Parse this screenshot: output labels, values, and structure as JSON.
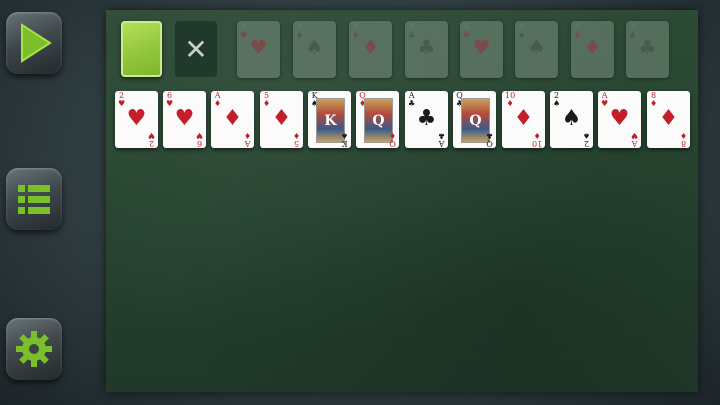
{
  "controls": {
    "play_icon": "play-icon",
    "menu_icon": "menu-list-icon",
    "settings_icon": "gear-icon",
    "accent": "#7bbf2a"
  },
  "stock": {
    "back_color": "#a6d448"
  },
  "waste": {
    "icon": "x-icon",
    "label": "✕"
  },
  "foundations": [
    {
      "rank": "A",
      "suit": "♥",
      "color": "red"
    },
    {
      "rank": "A",
      "suit": "♠",
      "color": "black"
    },
    {
      "rank": "A",
      "suit": "♦",
      "color": "red"
    },
    {
      "rank": "A",
      "suit": "♣",
      "color": "black"
    },
    {
      "rank": "A",
      "suit": "♥",
      "color": "red"
    },
    {
      "rank": "A",
      "suit": "♠",
      "color": "black"
    },
    {
      "rank": "A",
      "suit": "♦",
      "color": "red"
    },
    {
      "rank": "A",
      "suit": "♣",
      "color": "black"
    }
  ],
  "tableau": [
    {
      "rank": "2",
      "suit": "♥",
      "color": "red",
      "face": false
    },
    {
      "rank": "6",
      "suit": "♥",
      "color": "red",
      "face": false
    },
    {
      "rank": "A",
      "suit": "♦",
      "color": "red",
      "face": false
    },
    {
      "rank": "5",
      "suit": "♦",
      "color": "red",
      "face": false
    },
    {
      "rank": "K",
      "suit": "♠",
      "color": "black",
      "face": true
    },
    {
      "rank": "Q",
      "suit": "♦",
      "color": "red",
      "face": true
    },
    {
      "rank": "A",
      "suit": "♣",
      "color": "black",
      "face": false
    },
    {
      "rank": "Q",
      "suit": "♣",
      "color": "black",
      "face": true
    },
    {
      "rank": "10",
      "suit": "♦",
      "color": "red",
      "face": false
    },
    {
      "rank": "2",
      "suit": "♠",
      "color": "black",
      "face": false
    },
    {
      "rank": "A",
      "suit": "♥",
      "color": "red",
      "face": false
    },
    {
      "rank": "8",
      "suit": "♦",
      "color": "red",
      "face": false
    }
  ]
}
